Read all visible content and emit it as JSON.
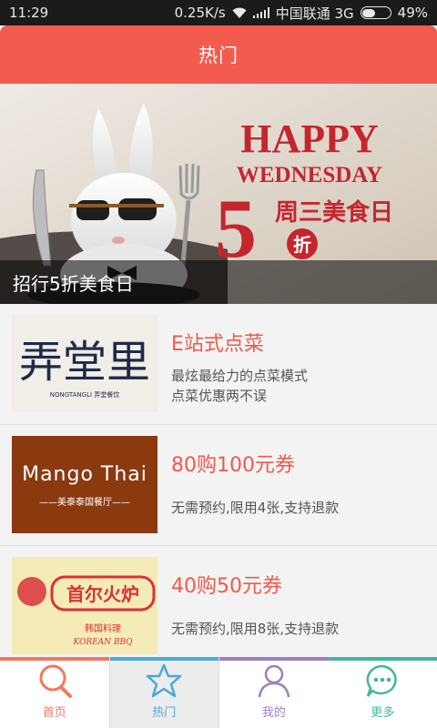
{
  "status_bar": {
    "time": "11:29",
    "network_speed": "0.25K/s",
    "carrier": "中国联通 3G",
    "battery": "49%",
    "battery_level": 0.49
  },
  "header": {
    "title": "热门"
  },
  "banner": {
    "caption": "招行5折美食日",
    "headline_1": "HAPPY",
    "headline_2": "WEDNESDAY",
    "big_number": "5",
    "subtitle": "周三美食日",
    "discount_char": "折"
  },
  "deals": [
    {
      "logo_text": "弄堂里",
      "logo_sub": "NONGTANGLI 弄堂餐饮",
      "title": "E站式点菜",
      "description": "最炫最给力的点菜模式\n点菜优惠两不误"
    },
    {
      "logo_text": "Mango Thai",
      "logo_sub": "——美泰泰国餐厅——",
      "title": "80购100元券",
      "description": "无需预约,限用4张,支持退款"
    },
    {
      "logo_text": "首尔火炉",
      "logo_sub": "韩国料理",
      "logo_sub_en": "KOREAN BBQ",
      "title": "40购50元券",
      "description": "无需预约,限用8张,支持退款"
    }
  ],
  "tabs": [
    {
      "label": "首页",
      "icon": "search-icon",
      "color": "#f0795f",
      "active": false
    },
    {
      "label": "热门",
      "icon": "star-icon",
      "color": "#4aa9d8",
      "active": true
    },
    {
      "label": "我的",
      "icon": "user-icon",
      "color": "#9b7fc0",
      "active": false
    },
    {
      "label": "更多",
      "icon": "more-icon",
      "color": "#3cb8a1",
      "active": false
    }
  ],
  "colors": {
    "accent": "#f35b4f",
    "deal_title": "#ee5a4c"
  }
}
